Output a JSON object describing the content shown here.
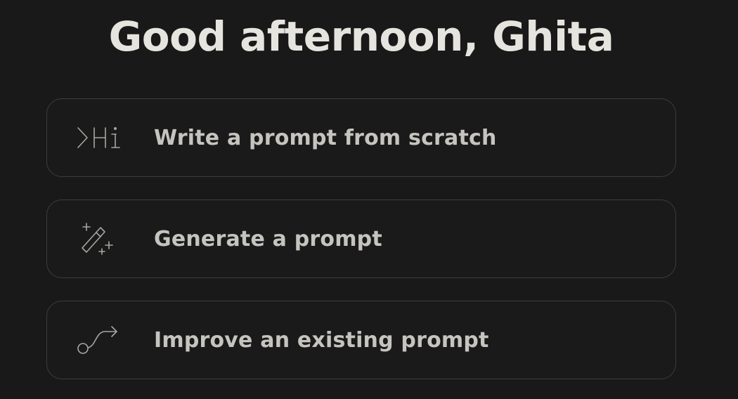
{
  "header": {
    "greeting": "Good afternoon, Ghita"
  },
  "options": [
    {
      "icon": "terminal-hi-icon",
      "label": "Write a prompt from scratch"
    },
    {
      "icon": "magic-wand-icon",
      "label": "Generate a prompt"
    },
    {
      "icon": "curve-arrow-icon",
      "label": "Improve an existing prompt"
    }
  ],
  "colors": {
    "background": "#191919",
    "card_border": "#3d3d3b",
    "heading": "#e6e4df",
    "label": "#c6c4bf",
    "icon": "#a8a6a1"
  }
}
